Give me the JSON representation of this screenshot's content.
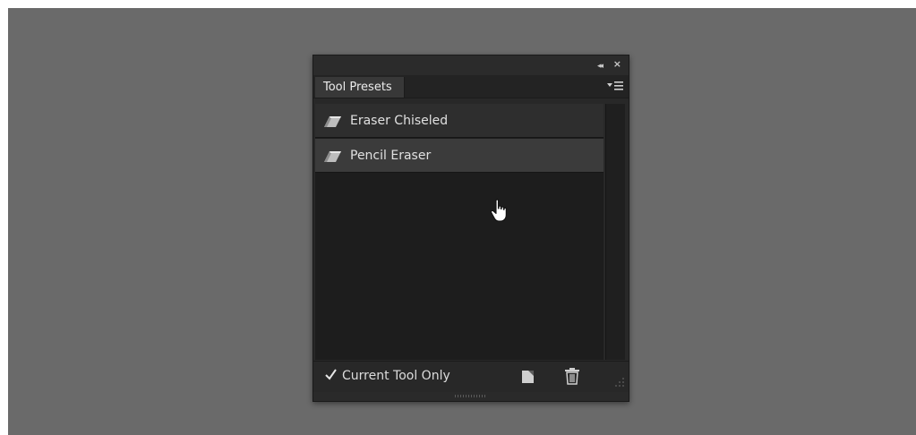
{
  "panel": {
    "tab_label": "Tool Presets",
    "controls": {
      "collapse_icon": "double-chevron-left-icon",
      "collapse_glyph": "◂◂",
      "close_icon": "close-icon",
      "close_glyph": "×",
      "menu_icon": "panel-menu-icon"
    },
    "items": [
      {
        "label": "Eraser Chiseled",
        "icon": "eraser-icon",
        "selected": false
      },
      {
        "label": "Pencil Eraser",
        "icon": "eraser-icon",
        "selected": true
      }
    ],
    "footer": {
      "checkbox_label": "Current Tool Only",
      "checkbox_checked": true,
      "new_icon": "new-preset-icon",
      "delete_icon": "trash-icon"
    }
  },
  "colors": {
    "workspace": "#6a6a6a",
    "panel_bg": "#282828",
    "list_bg": "#1d1d1d",
    "selected_row": "#3b3b3b",
    "text": "#e0e0e0"
  }
}
